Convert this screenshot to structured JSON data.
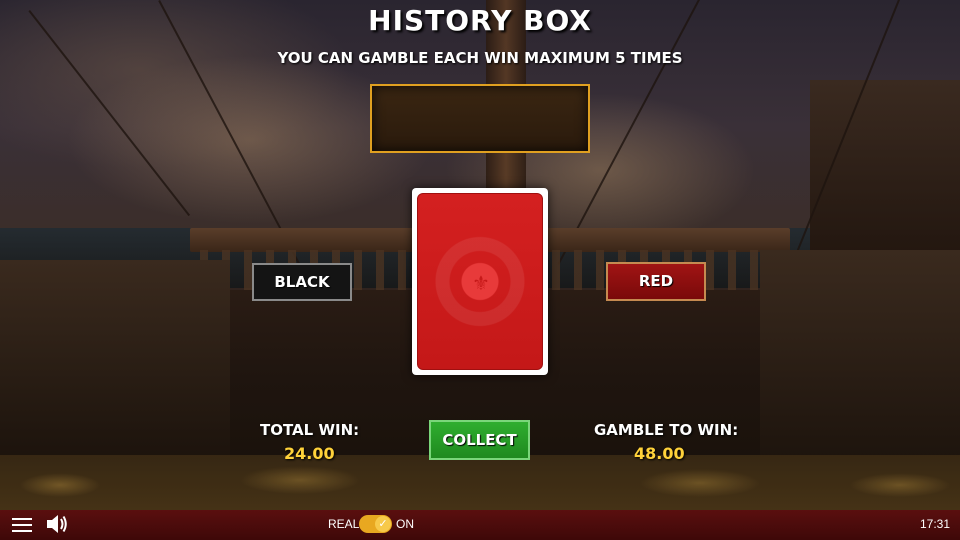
{
  "header": {
    "title": "HISTORY BOX",
    "subtitle": "YOU CAN GAMBLE EACH WIN MAXIMUM 5 TIMES"
  },
  "gamble": {
    "black_label": "BLACK",
    "red_label": "RED",
    "collect_label": "COLLECT",
    "card_state": "face-down"
  },
  "stats": {
    "total_win_label": "TOTAL WIN:",
    "total_win_value": "24.00",
    "gamble_to_win_label": "GAMBLE TO WIN:",
    "gamble_to_win_value": "48.00"
  },
  "bottom_bar": {
    "mode_left_label": "REAL",
    "mode_right_label": "ON",
    "clock": "17:31",
    "icons": [
      "menu-icon",
      "sound-icon",
      "check-icon"
    ]
  },
  "colors": {
    "accent_gold": "#e0a020",
    "value_yellow": "#ffd23a",
    "collect_green": "#2fae2f",
    "red_button": "#a01414",
    "bar_red": "#5a0f0f"
  }
}
